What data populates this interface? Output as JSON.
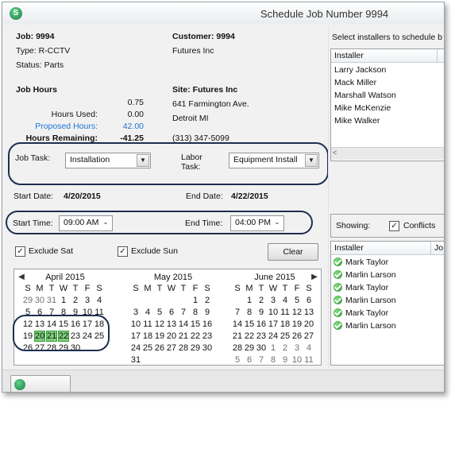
{
  "window": {
    "title": "Schedule Job Number 9994"
  },
  "job": {
    "job_label": "Job: 9994",
    "type_label": "Type: R-CCTV",
    "status_label": "Status: Parts"
  },
  "customer": {
    "label": "Customer: 9994",
    "name": "Futures  Inc"
  },
  "job_hours": {
    "heading": "Job Hours",
    "total": "0.75",
    "used_label": "Hours Used:",
    "used": "0.00",
    "proposed_label": "Proposed Hours:",
    "proposed": "42.00",
    "remaining_label": "Hours Remaining:",
    "remaining": "-41.25"
  },
  "site": {
    "label": "Site: Futures Inc",
    "address1": "641 Farmington Ave.",
    "address2": "Detroit MI",
    "phone": "(313) 347-5099"
  },
  "task": {
    "job_task_label": "Job Task:",
    "job_task_value": "Installation",
    "labor_task_label_1": "Labor",
    "labor_task_label_2": "Task:",
    "labor_task_value": "Equipment Install"
  },
  "dates": {
    "start_label": "Start Date:",
    "start_value": "4/20/2015",
    "end_label": "End Date:",
    "end_value": "4/22/2015"
  },
  "times": {
    "start_label": "Start Time:",
    "start_value": "09:00 AM",
    "end_label": "End Time:",
    "end_value": "04:00 PM"
  },
  "options": {
    "exclude_sat": "Exclude Sat",
    "exclude_sun": "Exclude Sun",
    "clear": "Clear"
  },
  "installers_panel": {
    "prompt": "Select installers to schedule b",
    "header": "Installer",
    "items": [
      "Larry Jackson",
      "Mack Miller",
      "Marshall Watson",
      "Mike McKenzie",
      "Mike Walker"
    ]
  },
  "conflicts_panel": {
    "showing_label": "Showing:",
    "conflicts_label": "Conflicts",
    "header_installer": "Installer",
    "header_jo": "Jo",
    "items": [
      "Mark Taylor",
      "Marlin Larson",
      "Mark Taylor",
      "Marlin Larson",
      "Mark Taylor",
      "Marlin Larson"
    ]
  },
  "calendar": {
    "weekdays": [
      "S",
      "M",
      "T",
      "W",
      "T",
      "F",
      "S"
    ],
    "months": [
      {
        "title": "April 2015",
        "rows": [
          [
            "29",
            "30",
            "31",
            "1",
            "2",
            "3",
            "4"
          ],
          [
            "5",
            "6",
            "7",
            "8",
            "9",
            "10",
            "11"
          ],
          [
            "12",
            "13",
            "14",
            "15",
            "16",
            "17",
            "18"
          ],
          [
            "19",
            "20",
            "21",
            "22",
            "23",
            "24",
            "25"
          ],
          [
            "26",
            "27",
            "28",
            "29",
            "30",
            "",
            ""
          ]
        ]
      },
      {
        "title": "May 2015",
        "rows": [
          [
            "",
            "",
            "",
            "",
            "",
            "1",
            "2"
          ],
          [
            "3",
            "4",
            "5",
            "6",
            "7",
            "8",
            "9"
          ],
          [
            "10",
            "11",
            "12",
            "13",
            "14",
            "15",
            "16"
          ],
          [
            "17",
            "18",
            "19",
            "20",
            "21",
            "22",
            "23"
          ],
          [
            "24",
            "25",
            "26",
            "27",
            "28",
            "29",
            "30"
          ],
          [
            "31",
            "",
            "",
            "",
            "",
            "",
            ""
          ]
        ]
      },
      {
        "title": "June 2015",
        "rows": [
          [
            "",
            "1",
            "2",
            "3",
            "4",
            "5",
            "6"
          ],
          [
            "7",
            "8",
            "9",
            "10",
            "11",
            "12",
            "13"
          ],
          [
            "14",
            "15",
            "16",
            "17",
            "18",
            "19",
            "20"
          ],
          [
            "21",
            "22",
            "23",
            "24",
            "25",
            "26",
            "27"
          ],
          [
            "28",
            "29",
            "30",
            "1",
            "2",
            "3",
            "4"
          ],
          [
            "5",
            "6",
            "7",
            "8",
            "9",
            "10",
            "11"
          ]
        ]
      }
    ]
  }
}
